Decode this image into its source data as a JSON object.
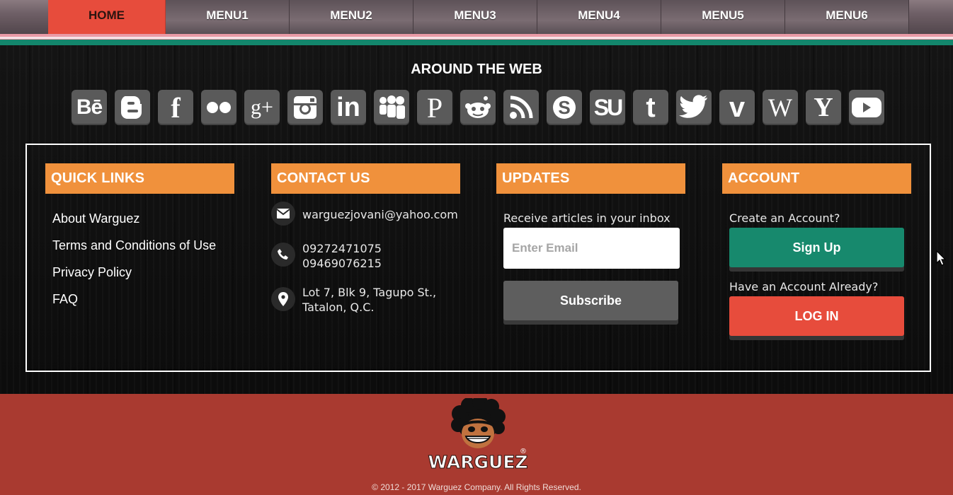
{
  "nav": {
    "items": [
      "HOME",
      "MENU1",
      "MENU2",
      "MENU3",
      "MENU4",
      "MENU5",
      "MENU6"
    ],
    "active": "HOME"
  },
  "around": {
    "title": "AROUND THE WEB",
    "icons": [
      "behance-icon",
      "blogger-icon",
      "facebook-icon",
      "flickr-icon",
      "google-plus-icon",
      "instagram-icon",
      "linkedin-icon",
      "myspace-icon",
      "pinterest-icon",
      "reddit-icon",
      "rss-icon",
      "skype-icon",
      "stumbleupon-icon",
      "tumblr-icon",
      "twitter-icon",
      "vimeo-icon",
      "wordpress-icon",
      "yahoo-icon",
      "youtube-icon"
    ],
    "icon_color": "#5a5a5a"
  },
  "quick_links": {
    "heading": "QUICK LINKS",
    "links": [
      "About Warguez",
      "Terms and Conditions of Use",
      "Privacy Policy",
      "FAQ"
    ]
  },
  "contact": {
    "heading": "CONTACT US",
    "email": "warguezjovani@yahoo.com",
    "phone1": "09272471075",
    "phone2": "09469076215",
    "address1": "Lot 7, Blk 9, Tagupo St.,",
    "address2": "Tatalon, Q.C."
  },
  "updates": {
    "heading": "UPDATES",
    "label": "Receive articles in your inbox",
    "placeholder": "Enter Email",
    "button": "Subscribe"
  },
  "account": {
    "heading": "ACCOUNT",
    "create_label": "Create an Account?",
    "signup": "Sign Up",
    "have_label": "Have an Account Already?",
    "login": "LOG IN"
  },
  "footer": {
    "brand": "WARGUEZ",
    "registered": "®",
    "copyright": "© 2012 - 2017 Warguez Company. All Rights Reserved."
  },
  "colors": {
    "accent_orange": "#f0913c",
    "green": "#17896d",
    "red": "#e74c3c",
    "footer_red": "#a93a30"
  }
}
